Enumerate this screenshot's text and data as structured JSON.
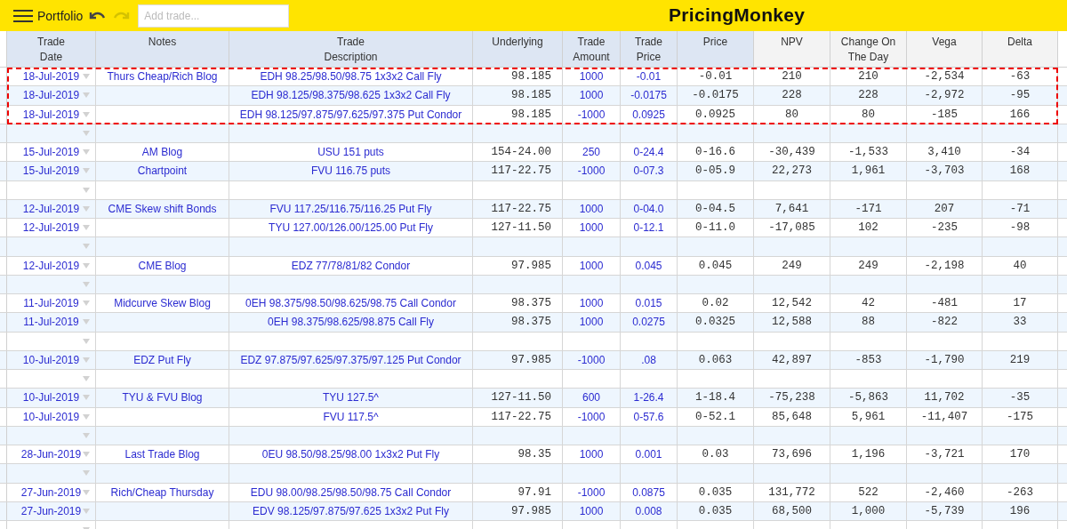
{
  "app_bar": {
    "menu_label": "Portfolio",
    "undo": {
      "disabled": false
    },
    "redo": {
      "disabled": true
    },
    "add_trade": {
      "placeholder": "Add trade..."
    },
    "logo": "PricingMonkey"
  },
  "table": {
    "columns": [
      {
        "label": "Trade\nDate",
        "kind": "input"
      },
      {
        "label": "Notes",
        "kind": "input"
      },
      {
        "label": "Trade\nDescription",
        "kind": "input"
      },
      {
        "label": "Underlying",
        "kind": "input"
      },
      {
        "label": "Trade\nAmount",
        "kind": "input"
      },
      {
        "label": "Trade\nPrice",
        "kind": "input"
      },
      {
        "label": "Price",
        "kind": "input"
      },
      {
        "label": "NPV",
        "kind": "computed"
      },
      {
        "label": "Change On\nThe Day",
        "kind": "computed"
      },
      {
        "label": "Vega",
        "kind": "computed"
      },
      {
        "label": "Delta",
        "kind": "computed"
      }
    ],
    "rows": [
      {
        "kind": "trade",
        "selected": true,
        "cells": [
          "18-Jul-2019",
          "Thurs Cheap/Rich Blog",
          "EDH 98.25/98.50/98.75 1x3x2 Call Fly",
          "98.185",
          "1000",
          "-0.01",
          "-0.01",
          "210",
          "210",
          "-2,534",
          "-63"
        ]
      },
      {
        "kind": "trade",
        "selected": true,
        "cells": [
          "18-Jul-2019",
          "",
          "EDH 98.125/98.375/98.625 1x3x2 Call Fly",
          "98.185",
          "1000",
          "-0.0175",
          "-0.0175",
          "228",
          "228",
          "-2,972",
          "-95"
        ]
      },
      {
        "kind": "trade",
        "selected": true,
        "cells": [
          "18-Jul-2019",
          "",
          "EDH 98.125/97.875/97.625/97.375 Put Condor",
          "98.185",
          "-1000",
          "0.0925",
          "0.0925",
          "80",
          "80",
          "-185",
          "166"
        ]
      },
      {
        "kind": "blank",
        "selected": false
      },
      {
        "kind": "trade",
        "selected": false,
        "cells": [
          "15-Jul-2019",
          "AM Blog",
          "USU 151 puts",
          "154-24.00",
          "250",
          "0-24.4",
          "0-16.6",
          "-30,439",
          "-1,533",
          "3,410",
          "-34"
        ]
      },
      {
        "kind": "trade",
        "selected": false,
        "cells": [
          "15-Jul-2019",
          "Chartpoint",
          "FVU 116.75 puts",
          "117-22.75",
          "-1000",
          "0-07.3",
          "0-05.9",
          "22,273",
          "1,961",
          "-3,703",
          "168"
        ]
      },
      {
        "kind": "blank",
        "selected": false
      },
      {
        "kind": "trade",
        "selected": false,
        "cells": [
          "12-Jul-2019",
          "CME Skew shift Bonds",
          "FVU 117.25/116.75/116.25 Put Fly",
          "117-22.75",
          "1000",
          "0-04.0",
          "0-04.5",
          "7,641",
          "-171",
          "207",
          "-71"
        ]
      },
      {
        "kind": "trade",
        "selected": false,
        "cells": [
          "12-Jul-2019",
          "",
          "TYU 127.00/126.00/125.00 Put Fly",
          "127-11.50",
          "1000",
          "0-12.1",
          "0-11.0",
          "-17,085",
          "102",
          "-235",
          "-98"
        ]
      },
      {
        "kind": "blank",
        "selected": false
      },
      {
        "kind": "trade",
        "selected": false,
        "cells": [
          "12-Jul-2019",
          "CME Blog",
          "EDZ 77/78/81/82 Condor",
          "97.985",
          "1000",
          "0.045",
          "0.045",
          "249",
          "249",
          "-2,198",
          "40"
        ]
      },
      {
        "kind": "blank",
        "selected": false
      },
      {
        "kind": "trade",
        "selected": false,
        "cells": [
          "11-Jul-2019",
          "Midcurve Skew Blog",
          "0EH 98.375/98.50/98.625/98.75 Call Condor",
          "98.375",
          "1000",
          "0.015",
          "0.02",
          "12,542",
          "42",
          "-481",
          "17"
        ]
      },
      {
        "kind": "trade",
        "selected": false,
        "cells": [
          "11-Jul-2019",
          "",
          "0EH 98.375/98.625/98.875 Call Fly",
          "98.375",
          "1000",
          "0.0275",
          "0.0325",
          "12,588",
          "88",
          "-822",
          "33"
        ]
      },
      {
        "kind": "blank",
        "selected": false
      },
      {
        "kind": "trade",
        "selected": false,
        "cells": [
          "10-Jul-2019",
          "EDZ Put Fly",
          "EDZ 97.875/97.625/97.375/97.125 Put Condor",
          "97.985",
          "-1000",
          ".08",
          "0.063",
          "42,897",
          "-853",
          "-1,790",
          "219"
        ]
      },
      {
        "kind": "blank",
        "selected": false
      },
      {
        "kind": "trade",
        "selected": false,
        "cells": [
          "10-Jul-2019",
          "TYU & FVU Blog",
          "TYU 127.5^",
          "127-11.50",
          "600",
          "1-26.4",
          "1-18.4",
          "-75,238",
          "-5,863",
          "11,702",
          "-35"
        ]
      },
      {
        "kind": "trade",
        "selected": false,
        "cells": [
          "10-Jul-2019",
          "",
          "FVU 117.5^",
          "117-22.75",
          "-1000",
          "0-57.6",
          "0-52.1",
          "85,648",
          "5,961",
          "-11,407",
          "-175"
        ]
      },
      {
        "kind": "blank",
        "selected": false
      },
      {
        "kind": "trade",
        "selected": false,
        "cells": [
          "28-Jun-2019",
          "Last Trade Blog",
          "0EU 98.50/98.25/98.00 1x3x2 Put Fly",
          "98.35",
          "1000",
          "0.001",
          "0.03",
          "73,696",
          "1,196",
          "-3,721",
          "170"
        ]
      },
      {
        "kind": "blank",
        "selected": false
      },
      {
        "kind": "trade",
        "selected": false,
        "cells": [
          "27-Jun-2019",
          "Rich/Cheap Thursday",
          "EDU 98.00/98.25/98.50/98.75 Call Condor",
          "97.91",
          "-1000",
          "0.0875",
          "0.035",
          "131,772",
          "522",
          "-2,460",
          "-263"
        ]
      },
      {
        "kind": "trade",
        "selected": false,
        "cells": [
          "27-Jun-2019",
          "",
          "EDV 98.125/97.875/97.625 1x3x2 Put Fly",
          "97.985",
          "1000",
          "0.008",
          "0.035",
          "68,500",
          "1,000",
          "-5,739",
          "196"
        ]
      },
      {
        "kind": "blank",
        "selected": false
      }
    ]
  }
}
